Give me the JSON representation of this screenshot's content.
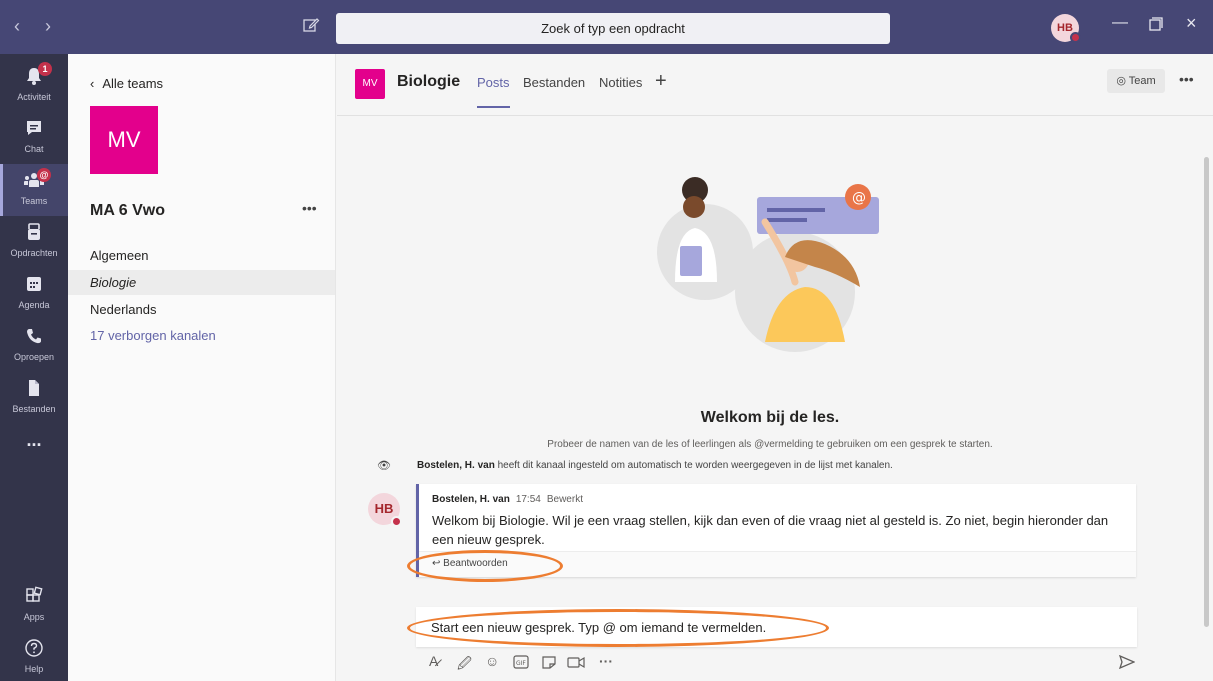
{
  "titlebar": {
    "search_text": "Zoek of typ een opdracht",
    "user_initials": "HB"
  },
  "rail": {
    "items": [
      {
        "label": "Activiteit",
        "icon": "bell-icon",
        "badge": "1"
      },
      {
        "label": "Chat",
        "icon": "chat-icon"
      },
      {
        "label": "Teams",
        "icon": "teams-icon",
        "badge": "@",
        "active": true
      },
      {
        "label": "Opdrachten",
        "icon": "assignments-icon"
      },
      {
        "label": "Agenda",
        "icon": "calendar-icon"
      },
      {
        "label": "Oproepen",
        "icon": "phone-icon"
      },
      {
        "label": "Bestanden",
        "icon": "files-icon"
      },
      {
        "label": "...",
        "icon": "more-icon"
      },
      {
        "label": "Apps",
        "icon": "apps-icon"
      },
      {
        "label": "Help",
        "icon": "help-icon"
      }
    ]
  },
  "panel": {
    "back_label": "Alle teams",
    "team_initials": "MV",
    "team_name": "MA 6 Vwo",
    "channels": [
      "Algemeen",
      "Biologie",
      "Nederlands"
    ],
    "active_channel": "Biologie",
    "hidden_channels": "17 verborgen kanalen"
  },
  "header": {
    "channel_initials": "MV",
    "channel_name": "Biologie",
    "tabs": [
      "Posts",
      "Bestanden",
      "Notities"
    ],
    "team_button": "Team"
  },
  "main": {
    "welcome_title": "Welkom bij de les.",
    "welcome_sub": "Probeer de namen van de les of leerlingen als @vermelding te gebruiken om een gesprek te starten.",
    "system_author": "Bostelen, H. van",
    "system_text": " heeft dit kanaal ingesteld om automatisch te worden weergegeven in de lijst met kanalen.",
    "post": {
      "initials": "HB",
      "author": "Bostelen, H. van",
      "time": "17:54",
      "edited": "Bewerkt",
      "body": "Welkom bij Biologie. Wil je een vraag stellen, kijk dan even of die vraag niet al gesteld is. Zo niet, begin hieronder dan een nieuw gesprek.",
      "reply_label": "Beantwoorden"
    },
    "compose_placeholder": "Start een nieuw gesprek. Typ @ om iemand te vermelden."
  },
  "colors": {
    "titlebar": "#464775",
    "rail": "#33344a",
    "accent": "#6264a7",
    "team_tile": "#e3008c",
    "highlight": "#ed7d31"
  }
}
